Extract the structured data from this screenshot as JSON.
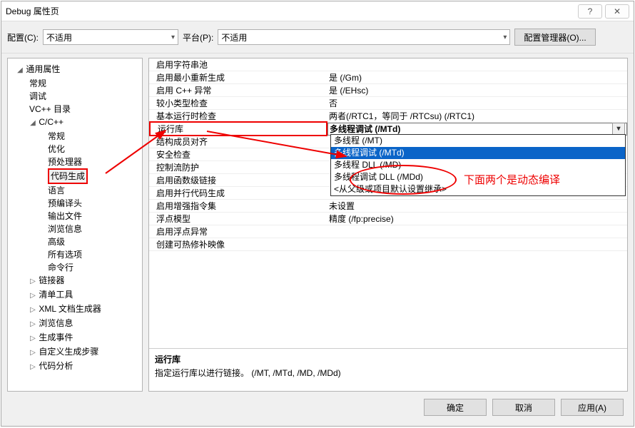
{
  "window": {
    "title": "Debug 属性页"
  },
  "toolbar": {
    "config_label": "配置(C):",
    "config_value": "不适用",
    "platform_label": "平台(P):",
    "platform_value": "不适用",
    "manager_btn": "配置管理器(O)..."
  },
  "tree": {
    "root": "通用属性",
    "items1": [
      "常规",
      "调试",
      "VC++ 目录"
    ],
    "cpp": "C/C++",
    "cpp_items": [
      "常规",
      "优化",
      "预处理器",
      "代码生成",
      "语言",
      "预编译头",
      "输出文件",
      "浏览信息",
      "高级",
      "所有选项",
      "命令行"
    ],
    "rest": [
      "链接器",
      "清单工具",
      "XML 文档生成器",
      "浏览信息",
      "生成事件",
      "自定义生成步骤",
      "代码分析"
    ]
  },
  "props": [
    {
      "name": "启用字符串池",
      "value": ""
    },
    {
      "name": "启用最小重新生成",
      "value": "是 (/Gm)"
    },
    {
      "name": "启用 C++ 异常",
      "value": "是 (/EHsc)"
    },
    {
      "name": "较小类型检查",
      "value": "否"
    },
    {
      "name": "基本运行时检查",
      "value": "两者(/RTC1，等同于 /RTCsu) (/RTC1)"
    },
    {
      "name": "运行库",
      "value": "多线程调试 (/MTd)",
      "selected": true
    },
    {
      "name": "结构成员对齐",
      "value": ""
    },
    {
      "name": "安全检查",
      "value": ""
    },
    {
      "name": "控制流防护",
      "value": ""
    },
    {
      "name": "启用函数级链接",
      "value": ""
    },
    {
      "name": "启用并行代码生成",
      "value": ""
    },
    {
      "name": "启用增强指令集",
      "value": "未设置"
    },
    {
      "name": "浮点模型",
      "value": "精度 (/fp:precise)"
    },
    {
      "name": "启用浮点异常",
      "value": ""
    },
    {
      "name": "创建可热修补映像",
      "value": ""
    }
  ],
  "dropdown": [
    "多线程 (/MT)",
    "多线程调试 (/MTd)",
    "多线程 DLL (/MD)",
    "多线程调试 DLL (/MDd)",
    "<从父级或项目默认设置继承>"
  ],
  "desc": {
    "title": "运行库",
    "text": "指定运行库以进行链接。     (/MT, /MTd, /MD, /MDd)"
  },
  "footer": {
    "ok": "确定",
    "cancel": "取消",
    "apply": "应用(A)"
  },
  "annotation": {
    "red_text": "下面两个是动态编译"
  }
}
